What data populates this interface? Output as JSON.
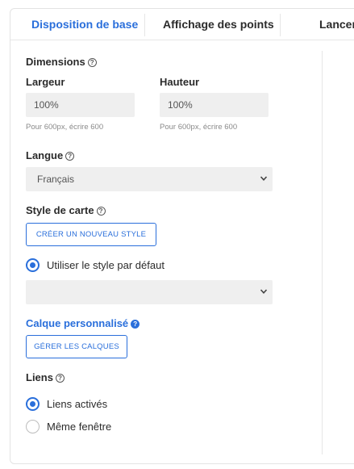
{
  "tabs": [
    {
      "label": "Disposition de base",
      "active": true
    },
    {
      "label": "Affichage des points",
      "active": false
    },
    {
      "label": "Lancem",
      "active": false
    }
  ],
  "dimensions": {
    "title": "Dimensions",
    "width_label": "Largeur",
    "width_value": "100%",
    "width_hint": "Pour 600px, écrire 600",
    "height_label": "Hauteur",
    "height_value": "100%",
    "height_hint": "Pour 600px, écrire 600"
  },
  "language": {
    "title": "Langue",
    "selected": "Français"
  },
  "map_style": {
    "title": "Style de carte",
    "create_button": "CRÉER UN NOUVEAU STYLE",
    "default_radio_label": "Utiliser le style par défaut",
    "default_radio_checked": true,
    "style_select_value": ""
  },
  "custom_layer": {
    "title": "Calque personnalisé",
    "manage_button": "GÉRER LES CALQUES"
  },
  "links": {
    "title": "Liens",
    "options": [
      {
        "label": "Liens activés",
        "checked": true
      },
      {
        "label": "Même fenêtre",
        "checked": false
      }
    ]
  },
  "colors": {
    "accent": "#2a6fdb",
    "field_bg": "#efefef"
  },
  "icons": {
    "help": "question-circle-icon",
    "select": "chevron-down-icon"
  }
}
